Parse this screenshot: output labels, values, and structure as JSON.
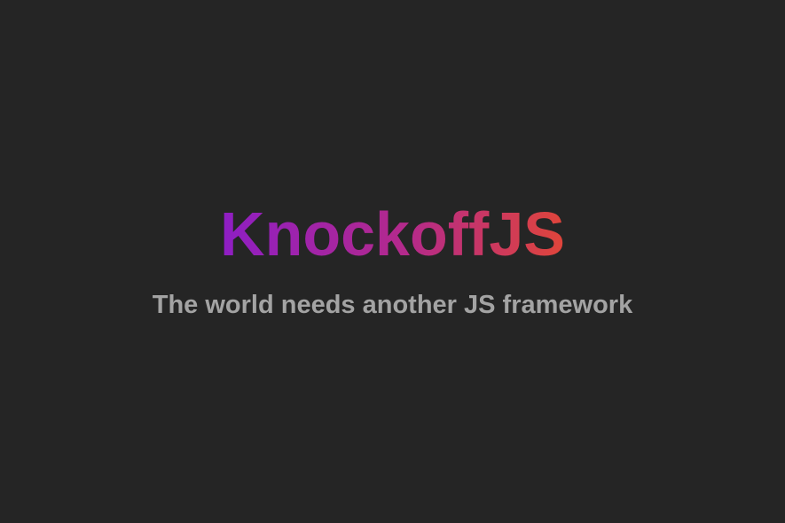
{
  "hero": {
    "title": "KnockoffJS",
    "subtitle": "The world needs another JS framework"
  },
  "colors": {
    "background": "#252525",
    "gradient_start": "#8e1ec4",
    "gradient_mid": "#b52a8a",
    "gradient_end": "#e0453a",
    "subtitle": "#a3a3a3"
  }
}
